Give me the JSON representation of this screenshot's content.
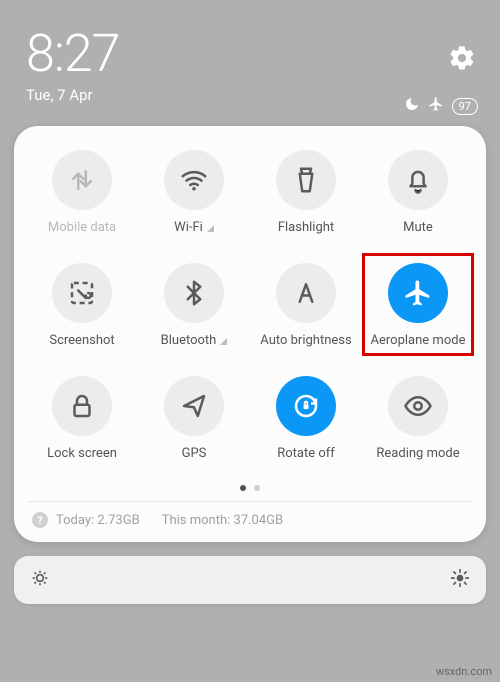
{
  "header": {
    "time": "8:27",
    "date": "Tue, 7 Apr",
    "battery": "97"
  },
  "tiles": [
    {
      "id": "mobile-data",
      "label": "Mobile data",
      "icon": "data-arrows",
      "state": "disabled",
      "tri": false,
      "highlight": false
    },
    {
      "id": "wifi",
      "label": "Wi-Fi",
      "icon": "wifi",
      "state": "off",
      "tri": true,
      "highlight": false
    },
    {
      "id": "flashlight",
      "label": "Flashlight",
      "icon": "flashlight",
      "state": "off",
      "tri": false,
      "highlight": false
    },
    {
      "id": "mute",
      "label": "Mute",
      "icon": "bell",
      "state": "off",
      "tri": false,
      "highlight": false
    },
    {
      "id": "screenshot",
      "label": "Screenshot",
      "icon": "screenshot",
      "state": "off",
      "tri": false,
      "highlight": false
    },
    {
      "id": "bluetooth",
      "label": "Bluetooth",
      "icon": "bluetooth",
      "state": "off",
      "tri": true,
      "highlight": false
    },
    {
      "id": "auto-brightness",
      "label": "Auto brightness",
      "icon": "auto-a",
      "state": "off",
      "tri": false,
      "highlight": false
    },
    {
      "id": "aeroplane-mode",
      "label": "Aeroplane mode",
      "icon": "plane",
      "state": "on",
      "tri": false,
      "highlight": true
    },
    {
      "id": "lock-screen",
      "label": "Lock screen",
      "icon": "lock",
      "state": "off",
      "tri": false,
      "highlight": false
    },
    {
      "id": "gps",
      "label": "GPS",
      "icon": "nav-arrow",
      "state": "off",
      "tri": false,
      "highlight": false
    },
    {
      "id": "rotate-off",
      "label": "Rotate off",
      "icon": "rotate-lock",
      "state": "on",
      "tri": false,
      "highlight": false
    },
    {
      "id": "reading-mode",
      "label": "Reading mode",
      "icon": "eye",
      "state": "off",
      "tri": false,
      "highlight": false
    }
  ],
  "data_usage": {
    "today_label": "Today:",
    "today_value": "2.73GB",
    "month_label": "This month:",
    "month_value": "37.04GB"
  },
  "watermark": "wsxdn.com"
}
